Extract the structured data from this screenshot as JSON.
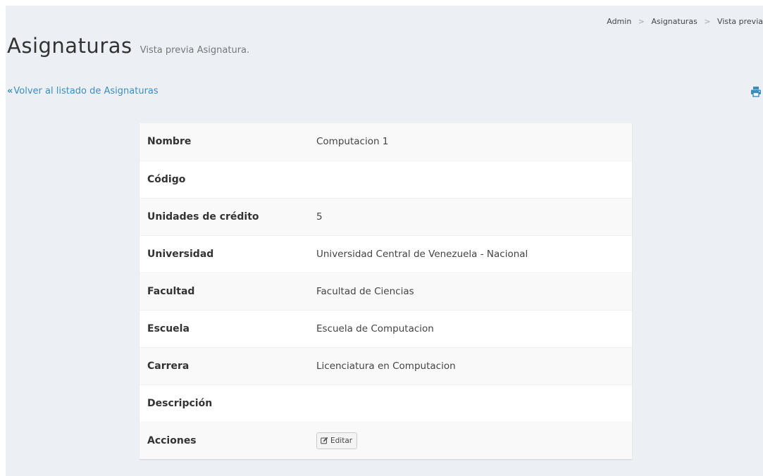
{
  "breadcrumb": {
    "items": [
      "Admin",
      "Asignaturas",
      "Vista previa"
    ],
    "separator": ">"
  },
  "header": {
    "title": "Asignaturas",
    "subtitle": "Vista previa Asignatura."
  },
  "back_link": {
    "icon": "double-chevron-left-icon",
    "symbol": "«",
    "label": "Volver al listado de Asignaturas"
  },
  "toolbar": {
    "print_icon": "print-icon"
  },
  "detail": {
    "rows": [
      {
        "label": "Nombre",
        "value": "Computacion 1"
      },
      {
        "label": "Código",
        "value": ""
      },
      {
        "label": "Unidades de crédito",
        "value": "5"
      },
      {
        "label": "Universidad",
        "value": "Universidad Central de Venezuela - Nacional"
      },
      {
        "label": "Facultad",
        "value": "Facultad de Ciencias"
      },
      {
        "label": "Escuela",
        "value": "Escuela de Computacion"
      },
      {
        "label": "Carrera",
        "value": "Licenciatura en Computacion"
      },
      {
        "label": "Descripción",
        "value": ""
      }
    ],
    "actions": {
      "label": "Acciones",
      "edit_button": "Editar",
      "edit_icon": "edit-icon"
    }
  },
  "colors": {
    "background": "#ecf0f5",
    "link": "#3c8dbc",
    "text": "#333333"
  }
}
